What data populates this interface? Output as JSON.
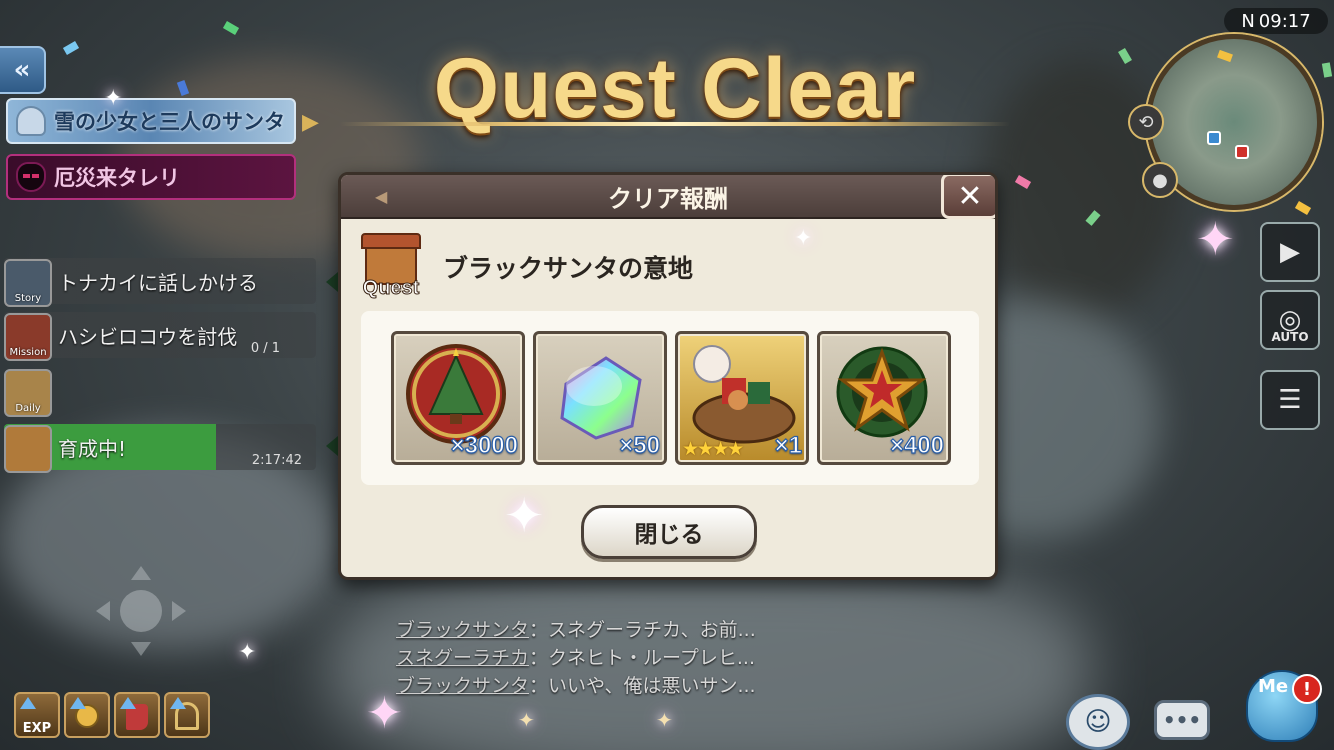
{
  "title": "Quest Clear",
  "status": {
    "time": "09:17",
    "signal": "N"
  },
  "events": [
    {
      "label": "雪の少女と三人のサンタ"
    },
    {
      "label": "厄災来タレリ"
    }
  ],
  "quests": [
    {
      "tag": "Story",
      "label": "トナカイに話しかける",
      "progress": ""
    },
    {
      "tag": "Mission",
      "label": "ハシビロコウを討伐",
      "progress": "0 / 1"
    },
    {
      "tag": "Daily",
      "label": "",
      "progress": ""
    },
    {
      "tag": "",
      "label": "育成中!",
      "timer": "2:17:42"
    }
  ],
  "boosts": [
    {
      "label": "EXP"
    },
    {
      "label": ""
    },
    {
      "label": ""
    },
    {
      "label": ""
    }
  ],
  "dialog": {
    "title": "クリア報酬",
    "quest_badge": "Quest",
    "quest_name": "ブラックサンタの意地",
    "close_label": "閉じる",
    "rewards": [
      {
        "icon": "christmas-tree-medal-icon",
        "count": "×3000",
        "stars": ""
      },
      {
        "icon": "rainbow-crystal-icon",
        "count": "×50",
        "stars": ""
      },
      {
        "icon": "santa-gift-basket-icon",
        "count": "×1",
        "stars": "★★★★"
      },
      {
        "icon": "star-wreath-icon",
        "count": "×400",
        "stars": ""
      }
    ]
  },
  "dialogue_log": [
    {
      "speaker": "ブラックサンタ",
      "text": "：スネグーラチカ、お前..."
    },
    {
      "speaker": "スネグーラチカ",
      "text": "：クネヒト・ループレヒ..."
    },
    {
      "speaker": "ブラックサンタ",
      "text": "：いいや、俺は悪いサン..."
    }
  ],
  "side_buttons": {
    "auto_label": "AUTO"
  },
  "mascot": {
    "label": "Me",
    "alert": "!"
  },
  "colors": {
    "accent_gold": "#f6d98a",
    "dialog_bg": "#efeadc",
    "training_green": "#3c9c3f"
  }
}
